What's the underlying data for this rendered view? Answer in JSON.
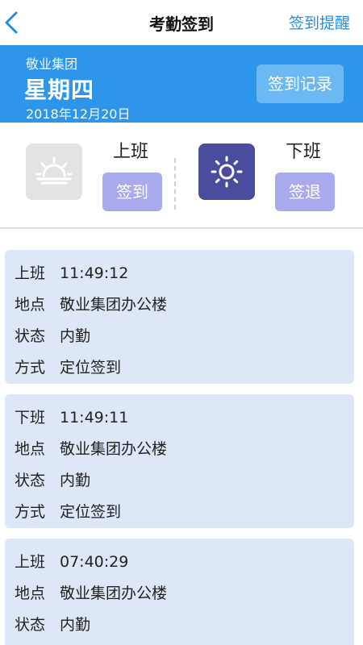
{
  "nav": {
    "title": "考勤签到",
    "action_label": "签到提醒"
  },
  "header": {
    "company": "敬业集团",
    "weekday": "星期四",
    "date": "2018年12月20日",
    "record_button": "签到记录"
  },
  "punch": {
    "on": {
      "label": "上班",
      "button": "签到"
    },
    "off": {
      "label": "下班",
      "button": "签退"
    }
  },
  "records": [
    {
      "rows": [
        {
          "k": "上班",
          "v": "11:49:12"
        },
        {
          "k": "地点",
          "v": "敬业集团办公楼"
        },
        {
          "k": "状态",
          "v": "内勤"
        },
        {
          "k": "方式",
          "v": "定位签到"
        }
      ]
    },
    {
      "rows": [
        {
          "k": "下班",
          "v": "11:49:11"
        },
        {
          "k": "地点",
          "v": "敬业集团办公楼"
        },
        {
          "k": "状态",
          "v": "内勤"
        },
        {
          "k": "方式",
          "v": "定位签到"
        }
      ]
    },
    {
      "rows": [
        {
          "k": "上班",
          "v": "07:40:29"
        },
        {
          "k": "地点",
          "v": "敬业集团办公楼"
        },
        {
          "k": "状态",
          "v": "内勤"
        }
      ]
    }
  ],
  "colors": {
    "accent": "#1f8fe6",
    "header_bg": "#2d95ea",
    "card_bg": "#dde7f7",
    "button_bg": "#a9a9ee",
    "night_icon_bg": "#4a4d9e"
  },
  "icons": {
    "back": "chevron-left-icon",
    "sunrise": "sunrise-icon",
    "sun": "sun-icon"
  }
}
